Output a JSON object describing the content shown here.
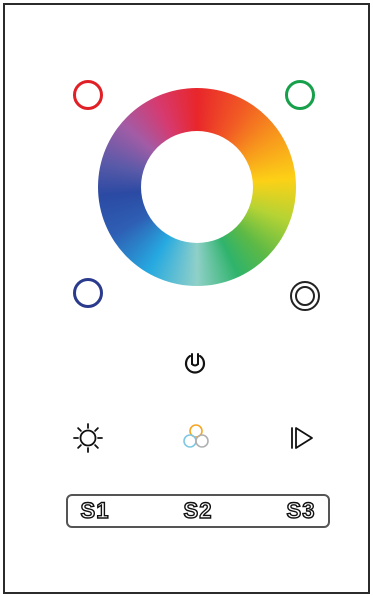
{
  "controls": {
    "channels": [
      {
        "id": "red",
        "color": "#e01f26"
      },
      {
        "id": "green",
        "color": "#16a04a"
      },
      {
        "id": "blue",
        "color": "#2a3a8c"
      }
    ],
    "white_icon": "double-circle-icon",
    "power_icon": "power-icon",
    "brightness_icon": "sun-icon",
    "color_mix_icon": "rgb-circles-icon",
    "play_icon": "play-icon"
  },
  "color_mix_colors": [
    "#f5a623",
    "#7ec8e3",
    "#b0b0b0"
  ],
  "scenes": [
    {
      "label": "S1"
    },
    {
      "label": "S2"
    },
    {
      "label": "S3"
    }
  ]
}
